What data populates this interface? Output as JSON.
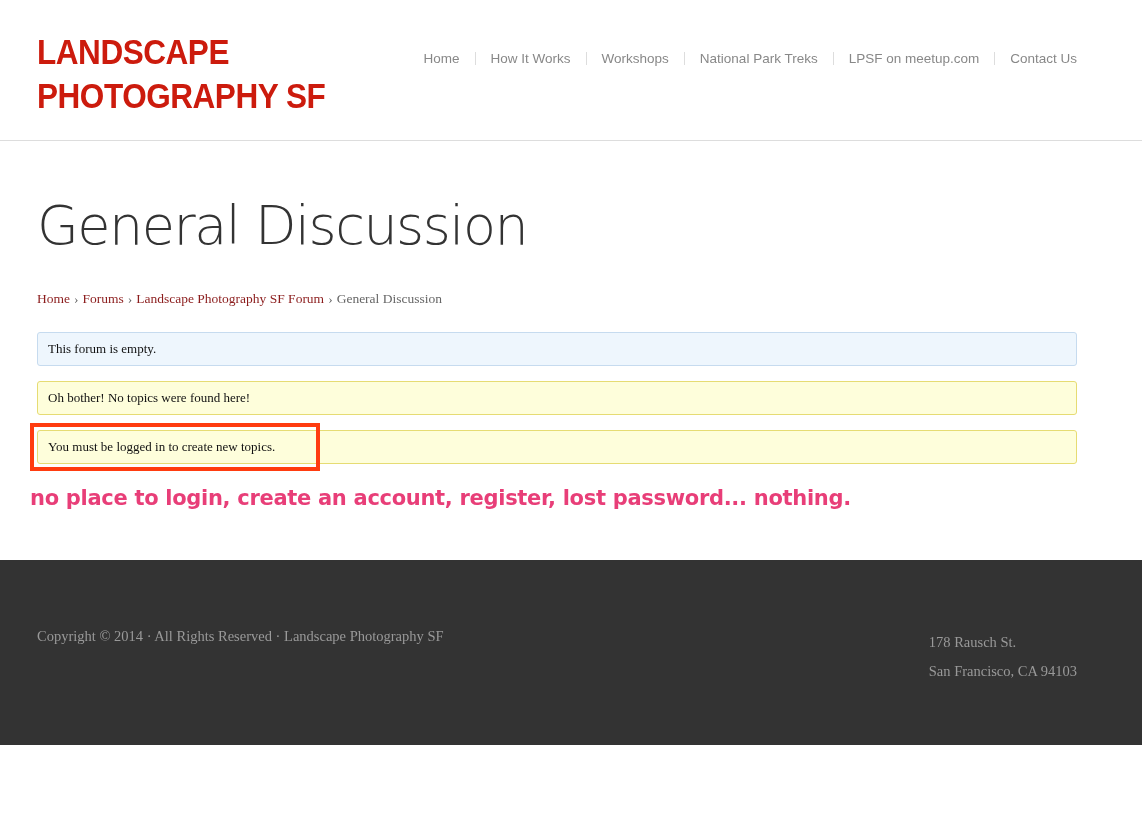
{
  "logo": {
    "lines": [
      "LANDSCAPE",
      "PHOTOGRAPHY SF"
    ]
  },
  "nav": [
    {
      "label": "Home"
    },
    {
      "label": "How It Works"
    },
    {
      "label": "Workshops"
    },
    {
      "label": "National Park Treks"
    },
    {
      "label": "LPSF on meetup.com"
    },
    {
      "label": "Contact Us"
    }
  ],
  "page_title": "General Discussion",
  "breadcrumb": {
    "separator": "›",
    "items": [
      {
        "label": "Home",
        "kind": "link"
      },
      {
        "label": "Forums",
        "kind": "link"
      },
      {
        "label": "Landscape Photography SF Forum",
        "kind": "link"
      },
      {
        "label": "General Discussion",
        "kind": "current"
      }
    ]
  },
  "notices": [
    {
      "text": "This forum is empty.",
      "kind": "info",
      "highlighted": false
    },
    {
      "text": "Oh bother! No topics were found here!",
      "kind": "warning",
      "highlighted": false
    },
    {
      "text": "You must be logged in to create new topics.",
      "kind": "warning",
      "highlighted": true
    }
  ],
  "annotation": "no place to login, create an account, register, lost password... nothing.",
  "footer": {
    "copyright": "Copyright © 2014 · All Rights Reserved · Landscape Photography SF",
    "address": [
      "178 Rausch St.",
      "San Francisco, CA 94103"
    ]
  }
}
